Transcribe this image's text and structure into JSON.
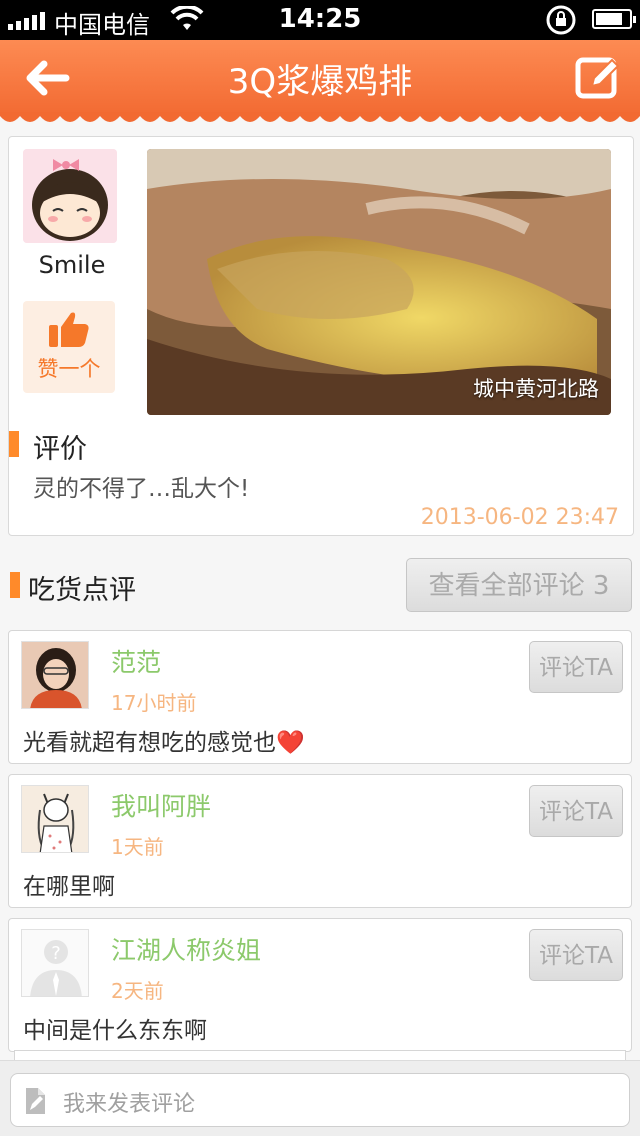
{
  "status_bar": {
    "carrier": "中国电信",
    "time": "14:25",
    "battery_level": 0.8
  },
  "nav": {
    "title": "3Q浆爆鸡排",
    "back_icon": "arrow-left-icon",
    "edit_icon": "edit-icon"
  },
  "post": {
    "user_name": "Smile",
    "like_label": "赞一个",
    "location": "城中黄河北路",
    "review_heading": "评价",
    "review_text": "灵的不得了…乱大个!",
    "date": "2013-06-02 23:47"
  },
  "comments_section": {
    "title": "吃货点评",
    "view_all_label": "查看全部评论 3"
  },
  "comments": [
    {
      "name": "范范",
      "time": "17小时前",
      "text": "光看就超有想吃的感觉也❤️",
      "reply_label": "评论TA"
    },
    {
      "name": "我叫阿胖",
      "time": "1天前",
      "text": "在哪里啊",
      "reply_label": "评论TA"
    },
    {
      "name": "江湖人称炎姐",
      "time": "2天前",
      "text": "中间是什么东东啊",
      "reply_label": "评论TA"
    }
  ],
  "input": {
    "placeholder": "我来发表评论"
  },
  "colors": {
    "nav": "#f47a40",
    "accent": "#ff8a2a",
    "name_green": "#8cc96b",
    "time_orange": "#f6b681"
  }
}
